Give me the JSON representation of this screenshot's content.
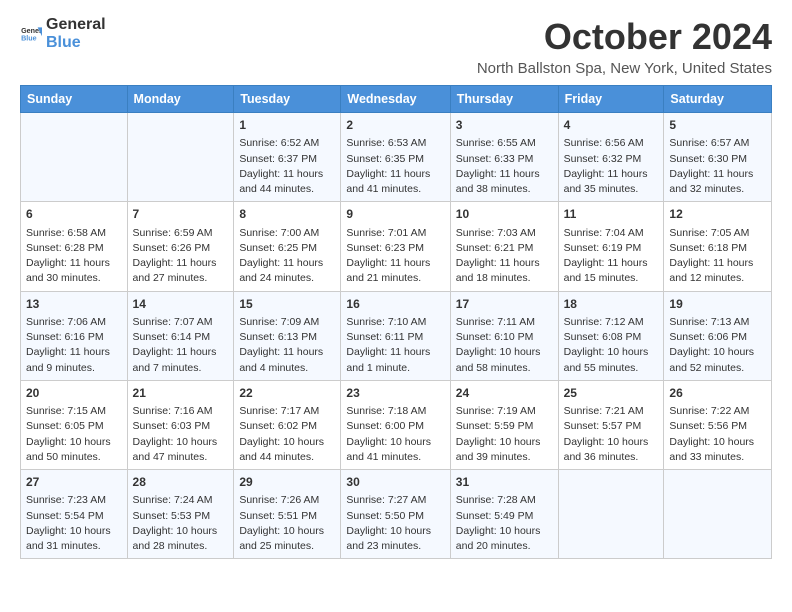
{
  "header": {
    "logo_general": "General",
    "logo_blue": "Blue",
    "month_title": "October 2024",
    "location": "North Ballston Spa, New York, United States"
  },
  "days_of_week": [
    "Sunday",
    "Monday",
    "Tuesday",
    "Wednesday",
    "Thursday",
    "Friday",
    "Saturday"
  ],
  "weeks": [
    [
      {
        "day": "",
        "info": ""
      },
      {
        "day": "",
        "info": ""
      },
      {
        "day": "1",
        "info": "Sunrise: 6:52 AM\nSunset: 6:37 PM\nDaylight: 11 hours and 44 minutes."
      },
      {
        "day": "2",
        "info": "Sunrise: 6:53 AM\nSunset: 6:35 PM\nDaylight: 11 hours and 41 minutes."
      },
      {
        "day": "3",
        "info": "Sunrise: 6:55 AM\nSunset: 6:33 PM\nDaylight: 11 hours and 38 minutes."
      },
      {
        "day": "4",
        "info": "Sunrise: 6:56 AM\nSunset: 6:32 PM\nDaylight: 11 hours and 35 minutes."
      },
      {
        "day": "5",
        "info": "Sunrise: 6:57 AM\nSunset: 6:30 PM\nDaylight: 11 hours and 32 minutes."
      }
    ],
    [
      {
        "day": "6",
        "info": "Sunrise: 6:58 AM\nSunset: 6:28 PM\nDaylight: 11 hours and 30 minutes."
      },
      {
        "day": "7",
        "info": "Sunrise: 6:59 AM\nSunset: 6:26 PM\nDaylight: 11 hours and 27 minutes."
      },
      {
        "day": "8",
        "info": "Sunrise: 7:00 AM\nSunset: 6:25 PM\nDaylight: 11 hours and 24 minutes."
      },
      {
        "day": "9",
        "info": "Sunrise: 7:01 AM\nSunset: 6:23 PM\nDaylight: 11 hours and 21 minutes."
      },
      {
        "day": "10",
        "info": "Sunrise: 7:03 AM\nSunset: 6:21 PM\nDaylight: 11 hours and 18 minutes."
      },
      {
        "day": "11",
        "info": "Sunrise: 7:04 AM\nSunset: 6:19 PM\nDaylight: 11 hours and 15 minutes."
      },
      {
        "day": "12",
        "info": "Sunrise: 7:05 AM\nSunset: 6:18 PM\nDaylight: 11 hours and 12 minutes."
      }
    ],
    [
      {
        "day": "13",
        "info": "Sunrise: 7:06 AM\nSunset: 6:16 PM\nDaylight: 11 hours and 9 minutes."
      },
      {
        "day": "14",
        "info": "Sunrise: 7:07 AM\nSunset: 6:14 PM\nDaylight: 11 hours and 7 minutes."
      },
      {
        "day": "15",
        "info": "Sunrise: 7:09 AM\nSunset: 6:13 PM\nDaylight: 11 hours and 4 minutes."
      },
      {
        "day": "16",
        "info": "Sunrise: 7:10 AM\nSunset: 6:11 PM\nDaylight: 11 hours and 1 minute."
      },
      {
        "day": "17",
        "info": "Sunrise: 7:11 AM\nSunset: 6:10 PM\nDaylight: 10 hours and 58 minutes."
      },
      {
        "day": "18",
        "info": "Sunrise: 7:12 AM\nSunset: 6:08 PM\nDaylight: 10 hours and 55 minutes."
      },
      {
        "day": "19",
        "info": "Sunrise: 7:13 AM\nSunset: 6:06 PM\nDaylight: 10 hours and 52 minutes."
      }
    ],
    [
      {
        "day": "20",
        "info": "Sunrise: 7:15 AM\nSunset: 6:05 PM\nDaylight: 10 hours and 50 minutes."
      },
      {
        "day": "21",
        "info": "Sunrise: 7:16 AM\nSunset: 6:03 PM\nDaylight: 10 hours and 47 minutes."
      },
      {
        "day": "22",
        "info": "Sunrise: 7:17 AM\nSunset: 6:02 PM\nDaylight: 10 hours and 44 minutes."
      },
      {
        "day": "23",
        "info": "Sunrise: 7:18 AM\nSunset: 6:00 PM\nDaylight: 10 hours and 41 minutes."
      },
      {
        "day": "24",
        "info": "Sunrise: 7:19 AM\nSunset: 5:59 PM\nDaylight: 10 hours and 39 minutes."
      },
      {
        "day": "25",
        "info": "Sunrise: 7:21 AM\nSunset: 5:57 PM\nDaylight: 10 hours and 36 minutes."
      },
      {
        "day": "26",
        "info": "Sunrise: 7:22 AM\nSunset: 5:56 PM\nDaylight: 10 hours and 33 minutes."
      }
    ],
    [
      {
        "day": "27",
        "info": "Sunrise: 7:23 AM\nSunset: 5:54 PM\nDaylight: 10 hours and 31 minutes."
      },
      {
        "day": "28",
        "info": "Sunrise: 7:24 AM\nSunset: 5:53 PM\nDaylight: 10 hours and 28 minutes."
      },
      {
        "day": "29",
        "info": "Sunrise: 7:26 AM\nSunset: 5:51 PM\nDaylight: 10 hours and 25 minutes."
      },
      {
        "day": "30",
        "info": "Sunrise: 7:27 AM\nSunset: 5:50 PM\nDaylight: 10 hours and 23 minutes."
      },
      {
        "day": "31",
        "info": "Sunrise: 7:28 AM\nSunset: 5:49 PM\nDaylight: 10 hours and 20 minutes."
      },
      {
        "day": "",
        "info": ""
      },
      {
        "day": "",
        "info": ""
      }
    ]
  ]
}
